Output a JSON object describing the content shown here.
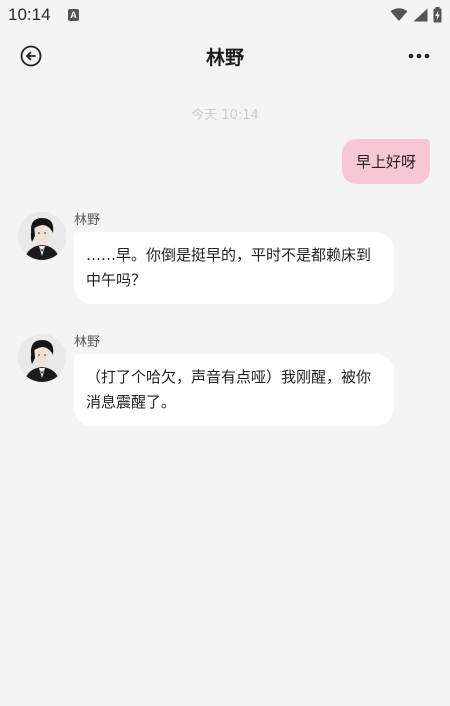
{
  "status_bar": {
    "time": "10:14",
    "app_icon_letter": "A"
  },
  "header": {
    "title": "林野"
  },
  "chat": {
    "timestamp": "今天 10:14",
    "messages": [
      {
        "side": "right",
        "text": "早上好呀"
      },
      {
        "side": "left",
        "sender": "林野",
        "text": "……早。你倒是挺早的，平时不是都赖床到中午吗？"
      },
      {
        "side": "left",
        "sender": "林野",
        "text": "（打了个哈欠，声音有点哑）我刚醒，被你消息震醒了。"
      }
    ]
  },
  "colors": {
    "background": "#f4f4f4",
    "sent_bubble": "#f9c6d4",
    "received_bubble": "#ffffff",
    "timestamp": "#c5ccd6"
  }
}
